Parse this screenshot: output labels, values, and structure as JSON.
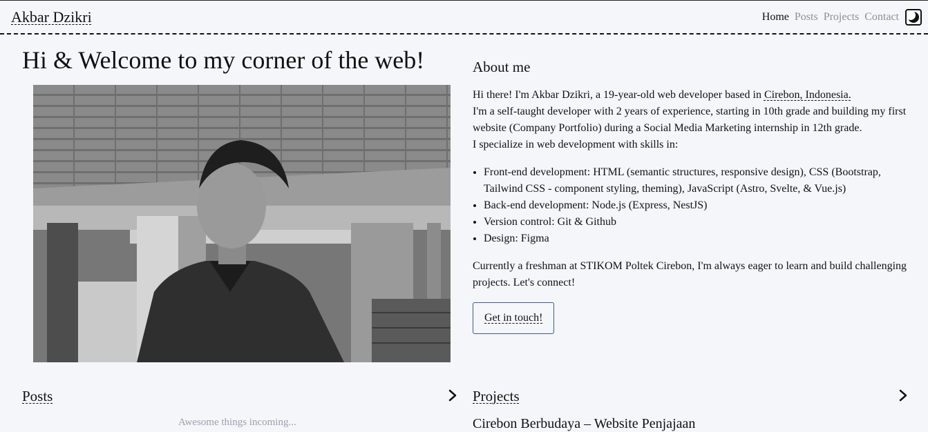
{
  "header": {
    "brand": "Akbar Dzikri",
    "nav": [
      "Home",
      "Posts",
      "Projects",
      "Contact"
    ],
    "active": "Home",
    "theme_toggle_icon": "moon-icon"
  },
  "hero": {
    "title": "Hi & Welcome to my corner of the web!",
    "photo_icon": "profile-photo"
  },
  "about": {
    "heading": "About me",
    "intro_prefix": "Hi there! I'm Akbar Dzikri, a 19-year-old web developer based in ",
    "location_link": "Cirebon, Indonesia.",
    "line2": "I'm a self-taught developer with 2 years of experience, starting in 10th grade and building my first website (Company Portfolio) during a Social Media Marketing internship in 12th grade.",
    "line3": "I specialize in web development with skills in:",
    "skills": [
      "Front-end development: HTML (semantic structures, responsive design), CSS (Bootstrap, Tailwind CSS - component styling, theming), JavaScript (Astro, Svelte, & Vue.js)",
      "Back-end development: Node.js (Express, NestJS)",
      "Version control: Git & Github",
      "Design: Figma"
    ],
    "outro": "Currently a freshman at STIKOM Poltek Cirebon, I'm always eager to learn and build challenging projects. Let's connect!",
    "cta_label": "Get in touch!"
  },
  "posts": {
    "heading": "Posts",
    "empty_text": "Awesome things incoming..."
  },
  "projects": {
    "heading": "Projects",
    "first_item": "Cirebon Berbudaya – Website Penjajaan"
  }
}
